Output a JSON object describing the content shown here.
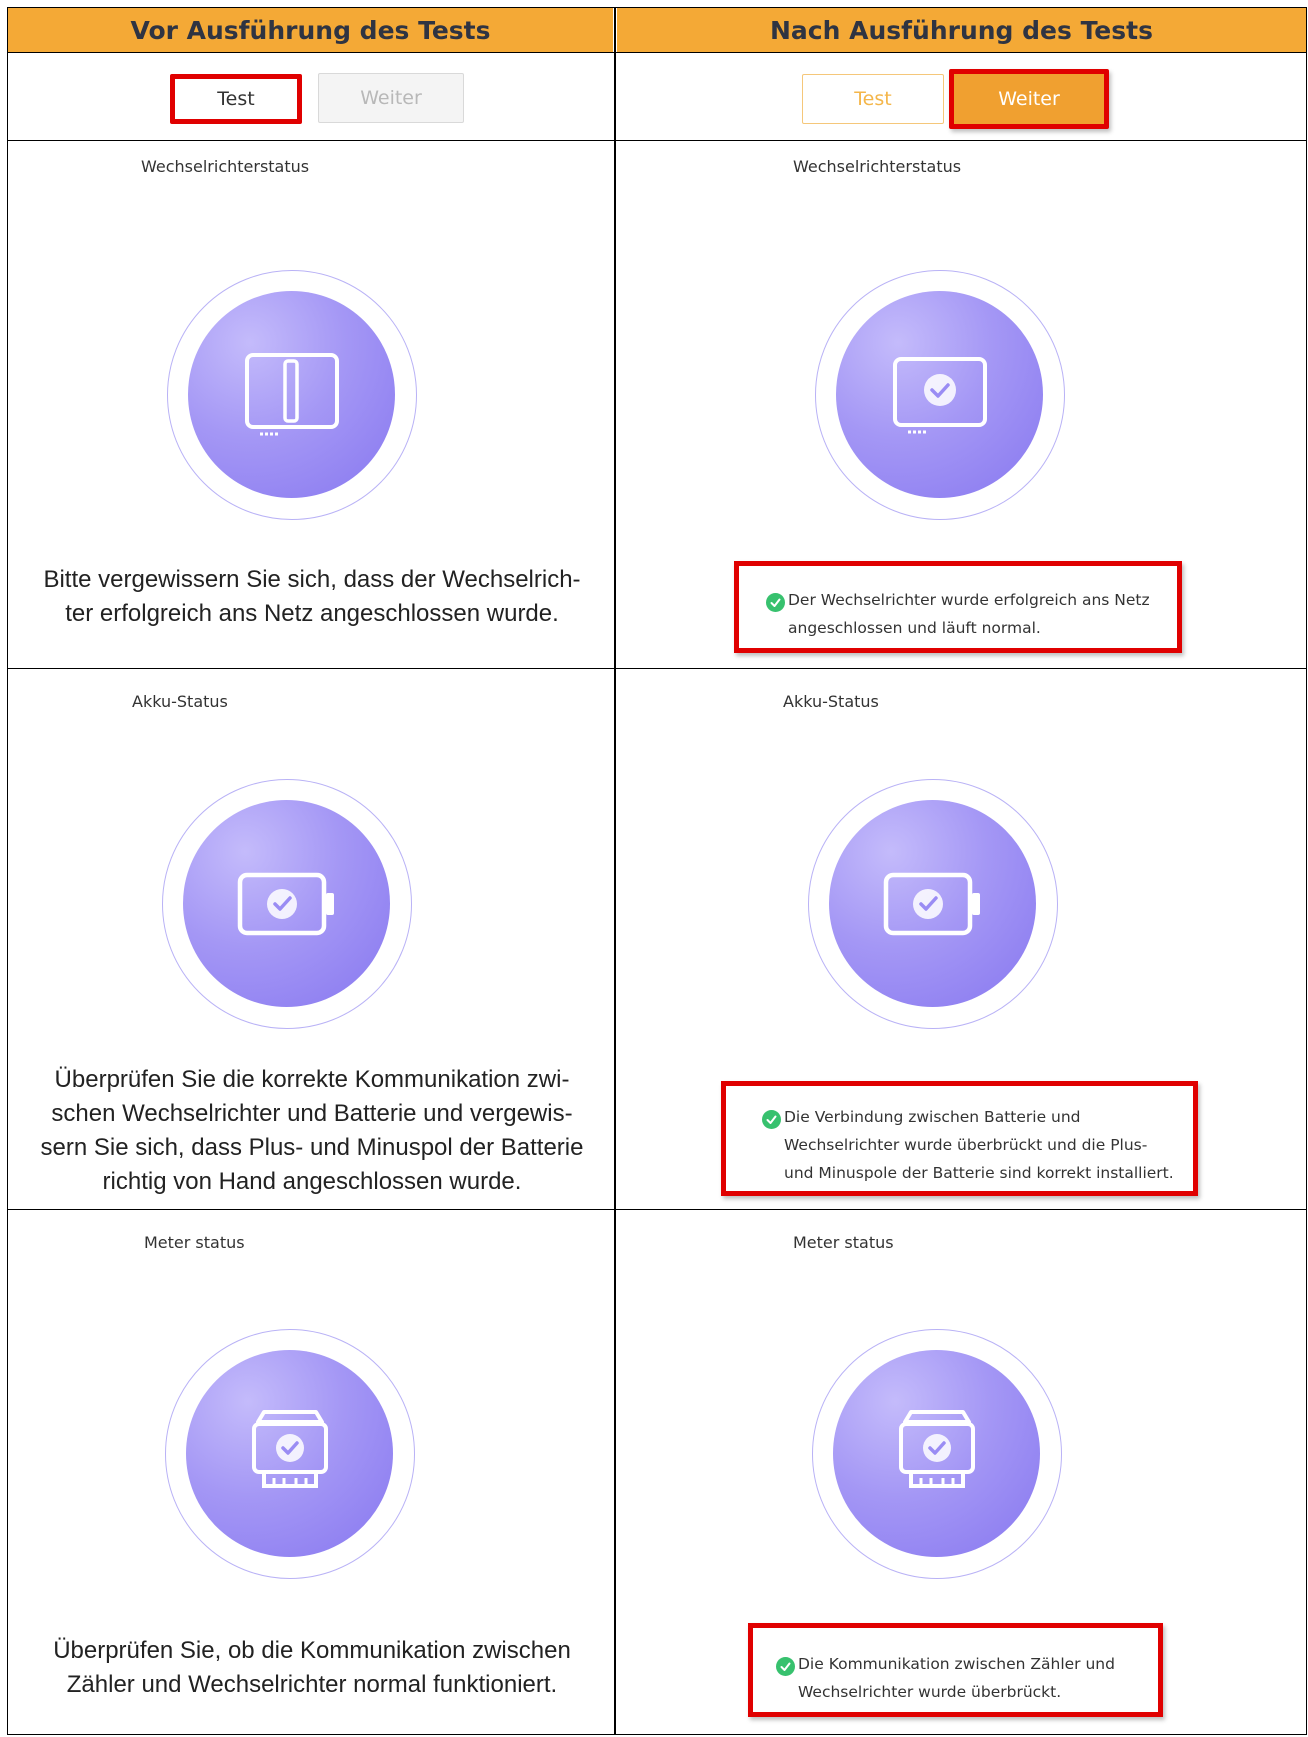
{
  "headers": {
    "before": "Vor Ausführung des Tests",
    "after": "Nach Ausführung des Tests"
  },
  "buttons": {
    "test": "Test",
    "weiter": "Weiter"
  },
  "sections": [
    {
      "title": "Wechselrichterstatus",
      "before_desc": [
        "Bitte vergewissern Sie sich, dass der Wechselrich-",
        "ter erfolgreich ans Netz angeschlossen wurde."
      ],
      "after_msg": [
        "Der Wechselrichter wurde erfolgreich ans Netz",
        "angeschlossen und läuft normal."
      ]
    },
    {
      "title": "Akku-Status",
      "before_desc": [
        "Überprüfen Sie die korrekte Kommunikation zwi-",
        "schen Wechselrichter und Batterie und vergewis-",
        "sern Sie sich, dass Plus- und Minuspol der Batterie",
        "richtig von Hand angeschlossen wurde."
      ],
      "after_msg": [
        "Die Verbindung zwischen Batterie und",
        "Wechselrichter wurde überbrückt und die Plus-",
        "und Minuspole der Batterie sind korrekt installiert."
      ]
    },
    {
      "title": "Meter status",
      "before_desc": [
        "Überprüfen Sie, ob die Kommunikation zwischen",
        "Zähler und Wechselrichter normal funktioniert."
      ],
      "after_msg": [
        "Die Kommunikation zwischen Zähler und",
        "Wechselrichter wurde überbrückt."
      ]
    }
  ],
  "colors": {
    "header_bg": "#F4A936",
    "highlight_border": "#E00000",
    "accent_orange": "#F0A030",
    "icon_purple": "#9a8cf4",
    "success_green": "#37c16e"
  }
}
